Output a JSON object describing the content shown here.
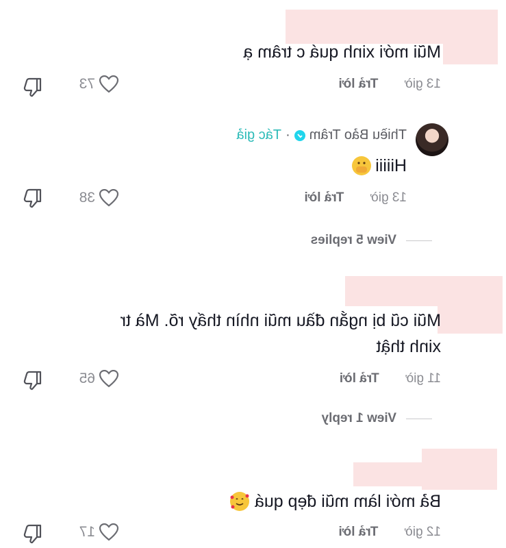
{
  "comments": [
    {
      "text": "Mũi mới xinh quá c trâm ạ",
      "time": "13 giờ",
      "reply_label": "Trả lời",
      "likes": "73"
    },
    {
      "author": "Thiều Bảo Trâm",
      "author_badge": "Tác giả",
      "text": "Hiiiii",
      "emoji": "hand-over-mouth",
      "time": "13 giờ",
      "reply_label": "Trả lời",
      "likes": "38",
      "view_replies": "View 5 replies"
    },
    {
      "text_line1": "Mũi cũ bị ngắn đầu mũi nhìn thấy rõ. Mà tr",
      "text_line2": "xinh thật",
      "time": "11 giờ",
      "reply_label": "Trả lời",
      "likes": "65",
      "view_replies": "View 1 reply"
    },
    {
      "text": "Bả mới làm mũi đẹp quá",
      "emoji": "smiling-face-with-hearts",
      "time": "12 giờ",
      "reply_label": "Trả lời",
      "likes": "17"
    }
  ],
  "colors": {
    "redaction": "#fbe3e3",
    "meta_text": "#8a8b91",
    "author_badge": "#2dbbb8",
    "verified": "#20d5ec"
  }
}
